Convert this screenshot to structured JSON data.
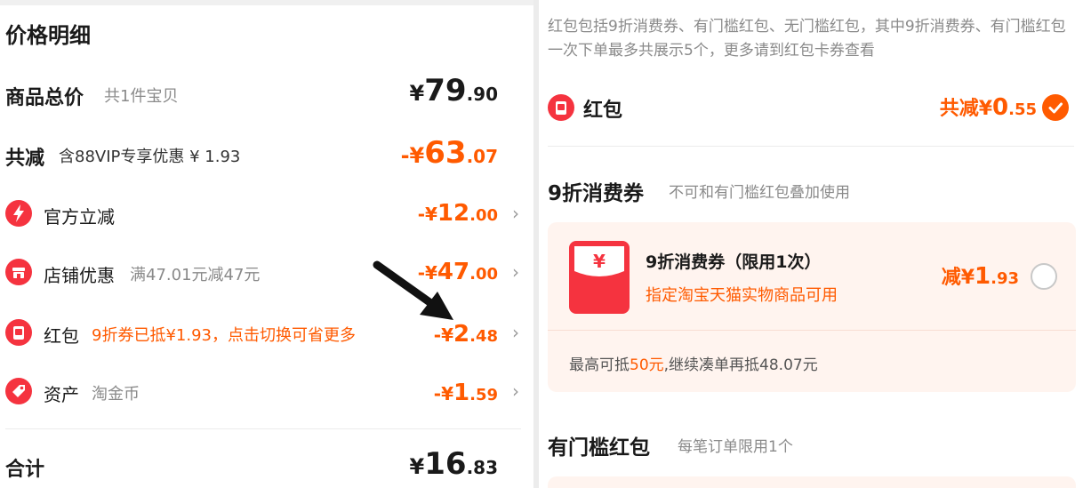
{
  "left": {
    "title": "价格明细",
    "goods": {
      "label": "商品总价",
      "sub": "共1件宝贝",
      "sign": "¥",
      "int": "79",
      "dec": ".90"
    },
    "discount": {
      "label": "共减",
      "sub": "含88VIP专享优惠 ¥ 1.93",
      "sign": "-¥",
      "int": "63",
      "dec": ".07"
    },
    "items": [
      {
        "label": "官方立减",
        "sub": "",
        "sign": "-¥",
        "int": "12",
        "dec": ".00",
        "icon": "lightning-icon"
      },
      {
        "label": "店铺优惠",
        "sub": "满47.01元减47元",
        "sign": "-¥",
        "int": "47",
        "dec": ".00",
        "icon": "shop-icon"
      },
      {
        "label": "红包",
        "sub": "9折券已抵¥1.93，点击切换可省更多",
        "sign": "-¥",
        "int": "2",
        "dec": ".48",
        "icon": "red-packet-icon"
      },
      {
        "label": "资产",
        "sub": "淘金币",
        "sign": "-¥",
        "int": "1",
        "dec": ".59",
        "icon": "tag-icon"
      }
    ],
    "chevron": "›",
    "total": {
      "label": "合计",
      "sign": "¥",
      "int": "16",
      "dec": ".83"
    }
  },
  "right": {
    "note": "红包包括9折消费券、有门槛红包、无门槛红包，其中9折消费券、有门槛红包一次下单最多共展示5个，更多请到红包卡券查看",
    "hongbao": {
      "label": "红包",
      "prefix": "共减¥",
      "int": "0",
      "dec": ".55"
    },
    "section1": {
      "title": "9折消费券",
      "sub": "不可和有门槛红包叠加使用"
    },
    "coupon": {
      "symbol": "¥",
      "title": "9折消费券（限用1次）",
      "desc": "指定淘宝天猫实物商品可用",
      "prefix": "减¥",
      "int": "1",
      "dec": ".93",
      "foot_a": "最高可抵",
      "foot_b": "50元",
      "foot_c": ",继续凑单再抵48.07元"
    },
    "section2": {
      "title": "有门槛红包",
      "sub": "每笔订单限用1个"
    }
  },
  "colors": {
    "accent": "#ff5a00",
    "text": "#1a1a1a",
    "muted": "#8a8a8a",
    "card_bg": "#fff4ef",
    "icon_red": "#f5333f"
  }
}
